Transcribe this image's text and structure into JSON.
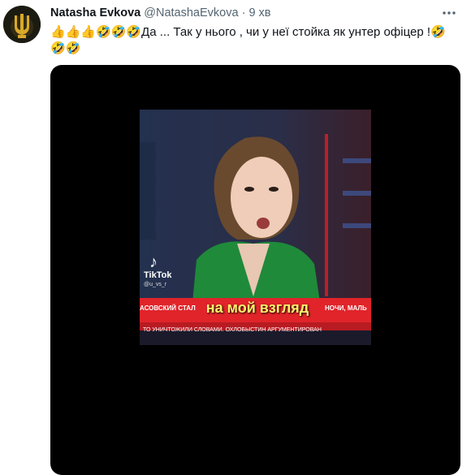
{
  "author": {
    "display_name": "Natasha Evkova",
    "handle": "@NatashaEvkova",
    "separator": "·",
    "time": "9 хв"
  },
  "tweet": {
    "text": "👍👍👍🤣🤣🤣Да ... Так у нього , чи у неї стойка як унтер офіцер  !🤣🤣🤣"
  },
  "media": {
    "watermark_logo": "TikTok",
    "watermark_user": "@u_vs_r",
    "ticker_left": "АСОВСКИЙ СТАЛ",
    "ticker_right": "НОЧИ, МАЛЬ",
    "ticker_lower": "ТО УНИЧТОЖИЛИ СЛОВАМИ. ОХЛОБЫСТИН АРГУМЕНТИРОВАН",
    "subtitle": "на мой взгляд"
  },
  "colors": {
    "name": "#0f1419",
    "meta": "#536471",
    "subtitle": "#fff36b",
    "ticker": "#e0242a"
  }
}
